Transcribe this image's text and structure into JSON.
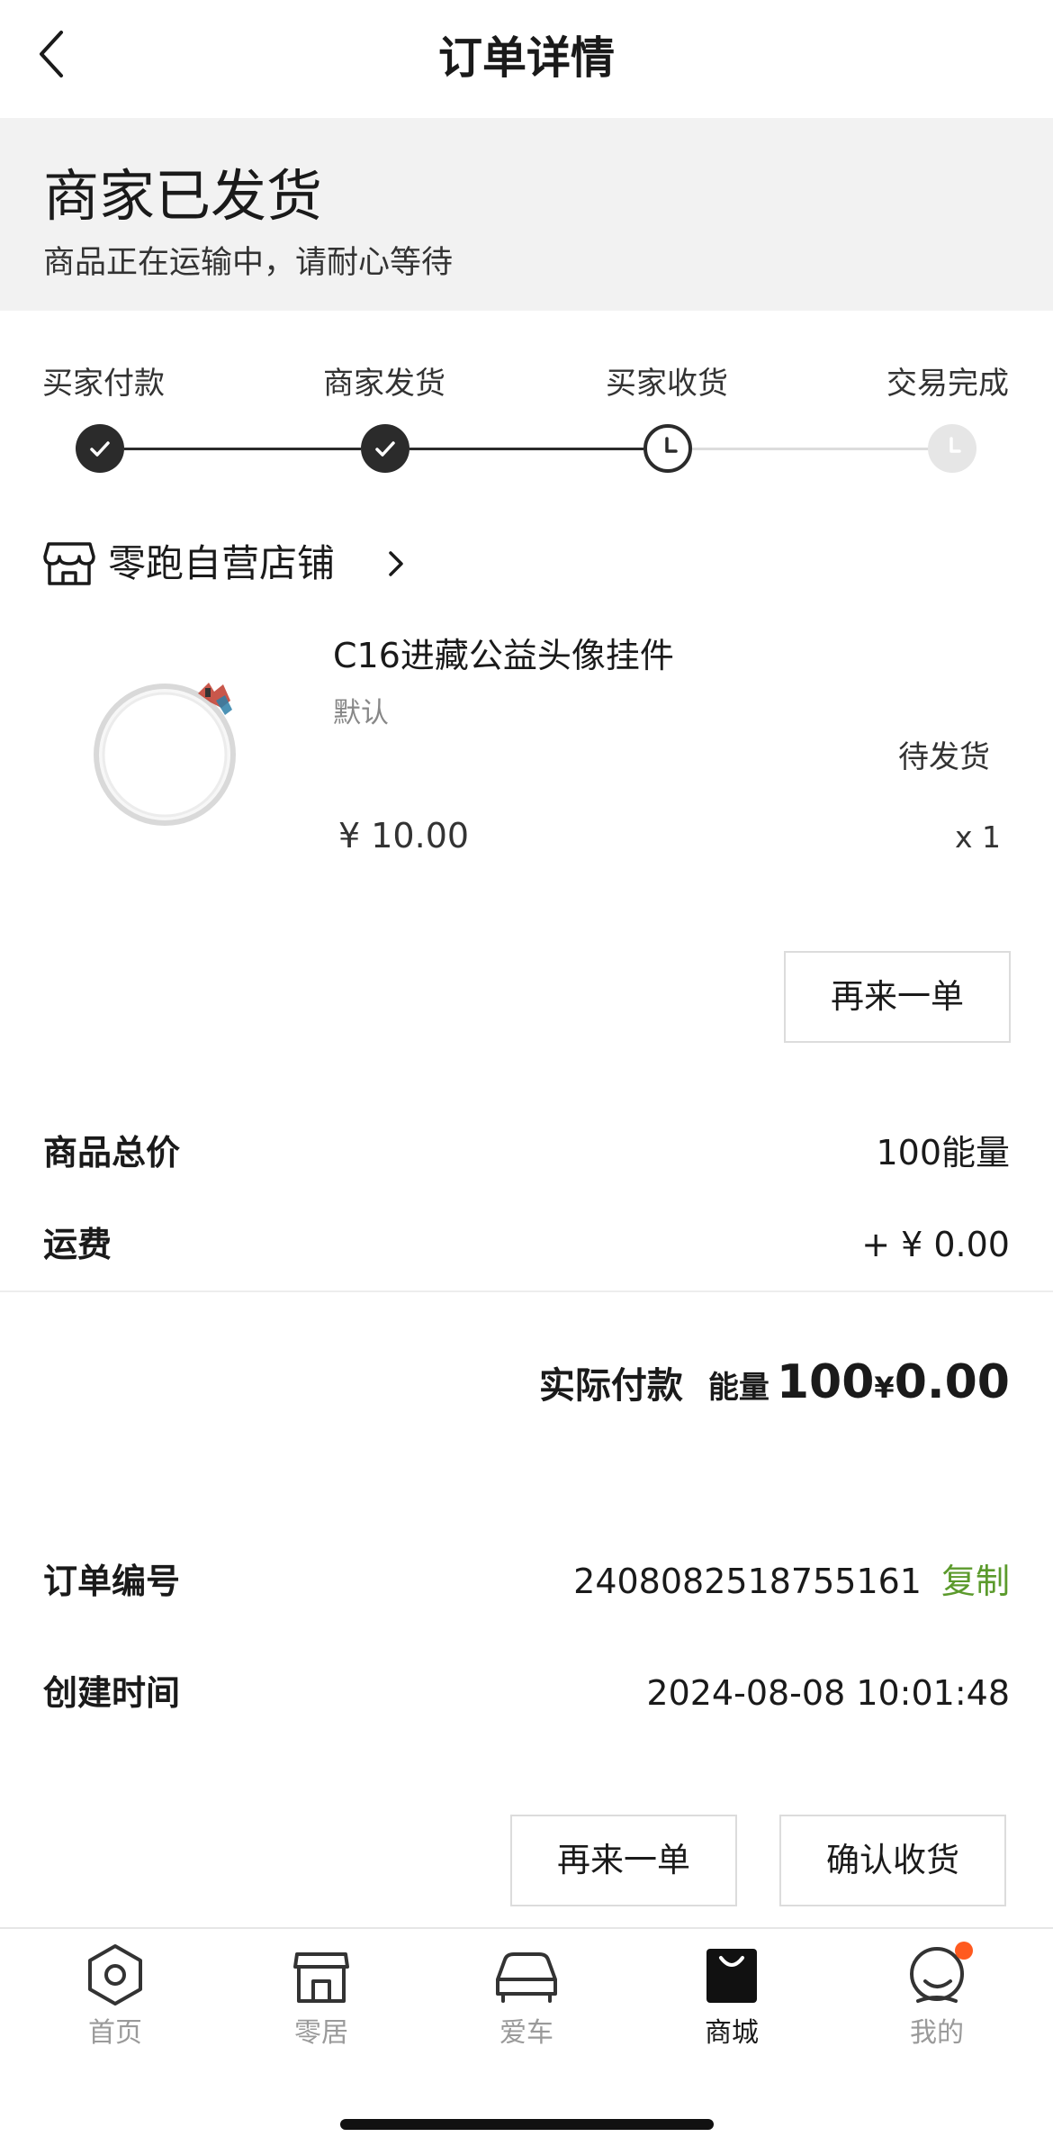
{
  "header": {
    "title": "订单详情"
  },
  "status": {
    "title": "商家已发货",
    "subtitle": "商品正在运输中，请耐心等待"
  },
  "progress": {
    "steps": [
      {
        "label": "买家付款",
        "state": "done"
      },
      {
        "label": "商家发货",
        "state": "done"
      },
      {
        "label": "买家收货",
        "state": "current"
      },
      {
        "label": "交易完成",
        "state": "todo"
      }
    ]
  },
  "store": {
    "name": "零跑自营店铺"
  },
  "product": {
    "name": "C16进藏公益头像挂件",
    "variant": "默认",
    "status": "待发货",
    "price": "¥ 10.00",
    "quantity": "x 1",
    "reorder_label": "再来一单"
  },
  "summary": {
    "goods_total_label": "商品总价",
    "goods_total_value": "100能量",
    "shipping_label": "运费",
    "shipping_value": "+ ¥ 0.00",
    "paid_label": "实际付款",
    "paid_energy_label": "能量",
    "paid_energy_value": "100",
    "paid_currency": "¥",
    "paid_amount": "0.00"
  },
  "order_info": {
    "number_label": "订单编号",
    "number_value": "2408082518755161",
    "copy_label": "复制",
    "created_label": "创建时间",
    "created_value": "2024-08-08 10:01:48"
  },
  "actions": {
    "reorder_label": "再来一单",
    "confirm_label": "确认收货"
  },
  "tabbar": {
    "items": [
      {
        "label": "首页",
        "icon": "hexagon-home-icon",
        "active": false
      },
      {
        "label": "零居",
        "icon": "house-icon",
        "active": false
      },
      {
        "label": "爱车",
        "icon": "car-icon",
        "active": false
      },
      {
        "label": "商城",
        "icon": "shopping-bag-icon",
        "active": true
      },
      {
        "label": "我的",
        "icon": "profile-icon",
        "active": false
      }
    ]
  },
  "colors": {
    "accent_green": "#5b9a2c",
    "badge_orange": "#ff5a1f",
    "banner_bg": "#f2f2f2"
  }
}
